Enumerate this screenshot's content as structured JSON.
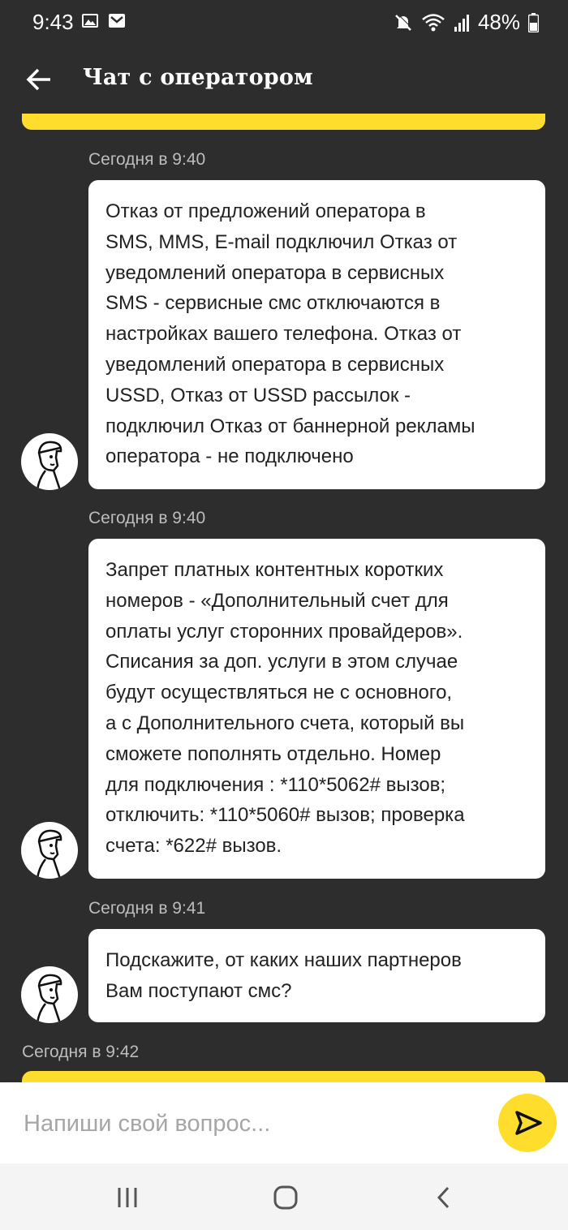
{
  "status_bar": {
    "time": "9:43",
    "battery": "48%"
  },
  "header": {
    "title": "Чат с оператором"
  },
  "messages": [
    {
      "timestamp": "Сегодня в 9:40",
      "text": "Отказ от предложений оператора в\nSMS, MMS, E-mail  подключил Отказ от\nуведомлений оператора в сервисных\nSMS - сервисные смс отключаются в\nнастройках вашего телефона. Отказ от\nуведомлений оператора в сервисных\nUSSD, Отказ от USSD рассылок  -\nподключил Отказ от баннерной рекламы\nоператора  - не подключено"
    },
    {
      "timestamp": "Сегодня в 9:40",
      "text": "Запрет платных контентных коротких\nномеров  - «Дополнительный счет для\nоплаты услуг сторонних провайдеров».\nСписания за доп. услуги в этом случае\nбудут осуществляться не с основного,\nа с Дополнительного счета, который вы\nсможете пополнять отдельно. Номер\nдля подключения : *110*5062# вызов;\nотключить: *110*5060# вызов; проверка\nсчета: *622# вызов."
    },
    {
      "timestamp": "Сегодня в 9:41",
      "text": "Подскажите, от каких наших партнеров\nВам поступают смс?"
    }
  ],
  "last_timestamp": "Сегодня в 9:42",
  "composer": {
    "placeholder": "Напиши свой вопрос..."
  },
  "colors": {
    "background": "#2d2d2d",
    "accent": "#ffdd2d",
    "bubble": "#ffffff"
  },
  "icons": [
    "back-arrow-icon",
    "image-icon",
    "mail-icon",
    "mute-icon",
    "wifi-icon",
    "signal-icon",
    "battery-icon",
    "send-icon",
    "recent-apps-icon",
    "home-icon",
    "nav-back-icon"
  ]
}
